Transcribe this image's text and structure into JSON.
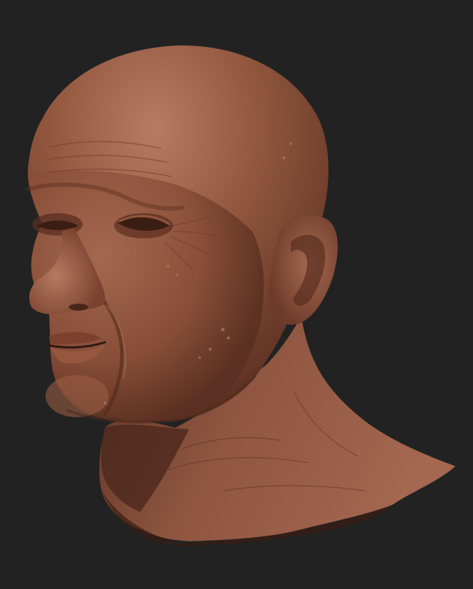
{
  "scene": {
    "background_color": "#222222",
    "subject": "sculpted-head-bust",
    "material_colors": {
      "base": "#8f5642",
      "highlight": "#b47a60",
      "shadow": "#4a271c",
      "deep_shadow": "#2e1710"
    }
  }
}
